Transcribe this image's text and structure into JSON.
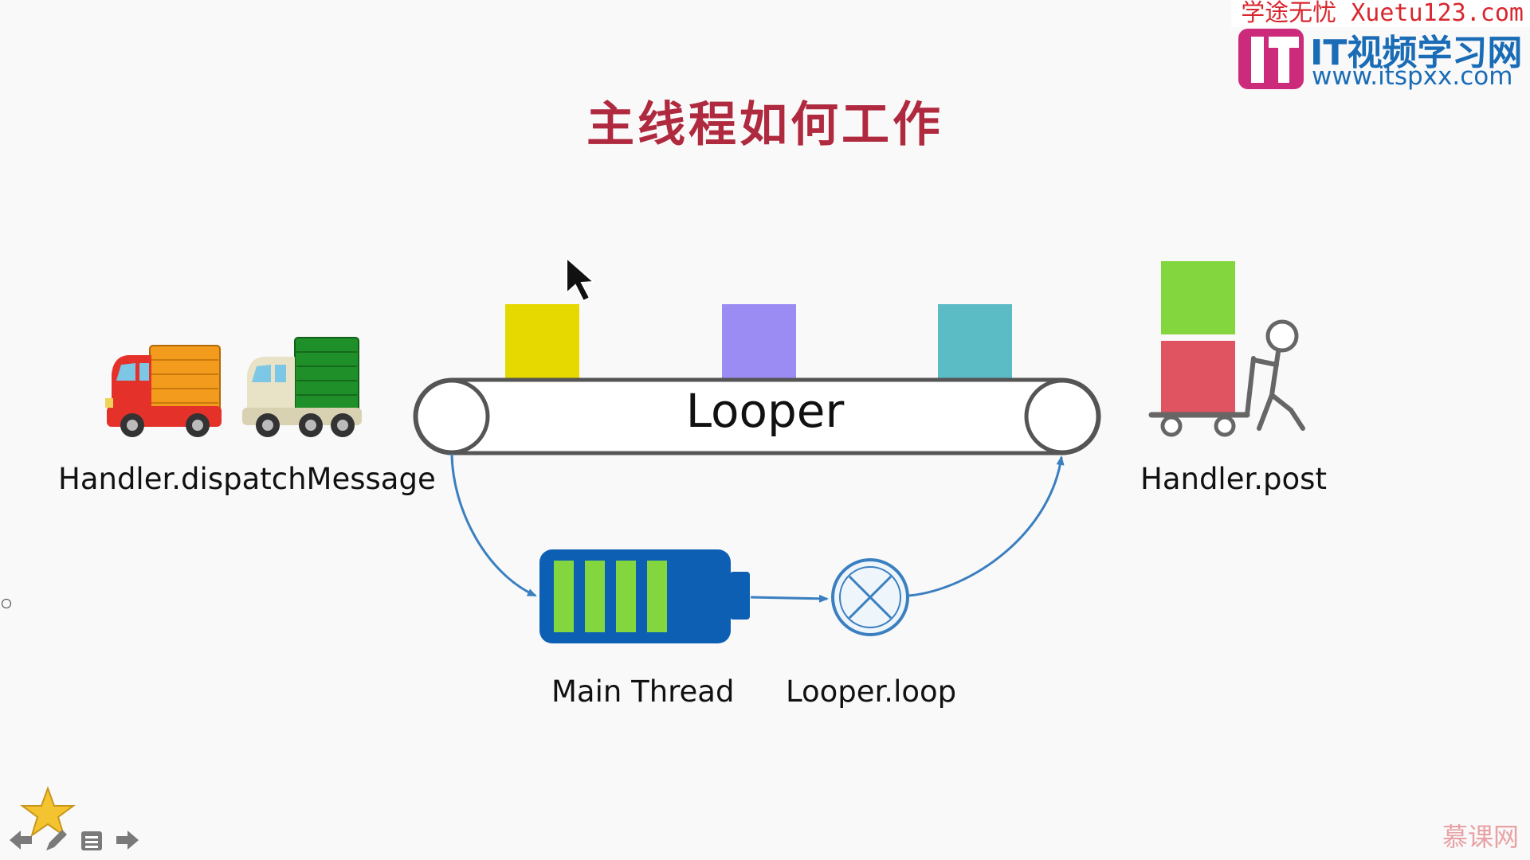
{
  "slide": {
    "title": "主线程如何工作",
    "looper_label": "Looper",
    "left_caption": "Handler.dispatchMessage",
    "right_caption": "Handler.post",
    "thread_caption": "Main Thread",
    "loop_caption": "Looper.loop"
  },
  "watermarks": {
    "top_banner": "学途无忧 Xuetu123.com",
    "it_logo_letter": "IT",
    "it_name": "IT视频学习网",
    "it_url": "www.itspxx.com",
    "bottom_right": "慕课网"
  },
  "colors": {
    "title": "#b02a3f",
    "message_yellow": "#e6d900",
    "message_purple": "#9b8cf4",
    "message_teal": "#5bbcc6",
    "stack_green": "#84d63f",
    "stack_red": "#e05361",
    "battery_blue": "#0d5fb3",
    "battery_cells": "#84d63f",
    "arrow_blue": "#3a7fc0"
  },
  "icons": {
    "cursor": "arrow-cursor-icon",
    "truck_orange": "delivery-truck-icon",
    "truck_green": "delivery-truck-icon",
    "hand_cart": "person-pushing-cart-icon",
    "battery": "battery-icon",
    "loop_symbol": "circled-x-icon",
    "star": "star-icon",
    "nav_prev": "arrow-left-icon",
    "nav_pen": "pen-icon",
    "nav_menu": "menu-icon",
    "nav_next": "arrow-right-icon"
  }
}
